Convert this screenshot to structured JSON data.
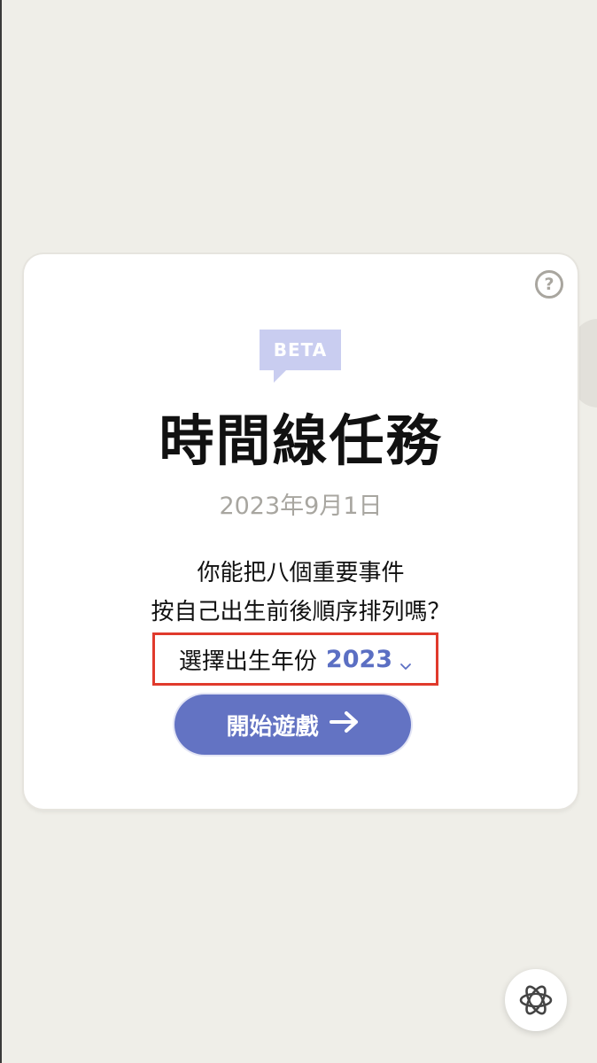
{
  "badge": {
    "label": "BETA"
  },
  "game": {
    "title": "時間線任務",
    "date": "2023年9月1日",
    "question_line1": "你能把八個重要事件",
    "question_line2": "按自己出生前後順序排列嗎？"
  },
  "year_select": {
    "label": "選擇出生年份",
    "value": "2023"
  },
  "start_button": {
    "label": "開始遊戲"
  },
  "help": {
    "glyph": "?"
  },
  "colors": {
    "accent": "#6373c3",
    "badge": "#c9cdf0",
    "highlight_border": "#e03a2c",
    "background": "#efeee8"
  },
  "icons": [
    "help-icon",
    "chevron-down-icon",
    "arrow-right-icon",
    "openai-logo-icon"
  ]
}
